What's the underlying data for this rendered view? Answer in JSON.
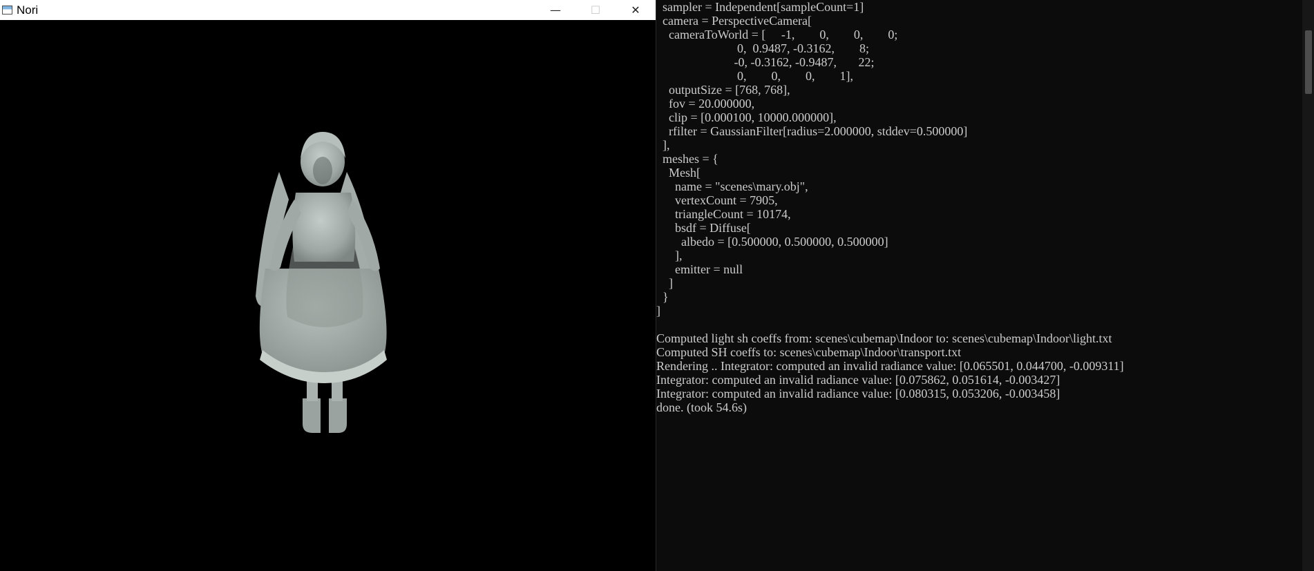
{
  "nori_window": {
    "title": "Nori",
    "app_icon": "window-icon",
    "controls": {
      "minimize": "—",
      "maximize": "☐",
      "close": "✕"
    }
  },
  "console": {
    "lines": [
      "  sampler = Independent[sampleCount=1]",
      "  camera = PerspectiveCamera[",
      "    cameraToWorld = [     -1,        0,        0,        0;",
      "                          0,  0.9487, -0.3162,        8;",
      "                         -0, -0.3162, -0.9487,       22;",
      "                          0,        0,        0,        1],",
      "    outputSize = [768, 768],",
      "    fov = 20.000000,",
      "    clip = [0.000100, 10000.000000],",
      "    rfilter = GaussianFilter[radius=2.000000, stddev=0.500000]",
      "  ],",
      "  meshes = {",
      "    Mesh[",
      "      name = \"scenes\\mary.obj\",",
      "      vertexCount = 7905,",
      "      triangleCount = 10174,",
      "      bsdf = Diffuse[",
      "        albedo = [0.500000, 0.500000, 0.500000]",
      "      ],",
      "      emitter = null",
      "    ]",
      "  }",
      "]",
      "",
      "Computed light sh coeffs from: scenes\\cubemap\\Indoor to: scenes\\cubemap\\Indoor\\light.txt",
      "Computed SH coeffs to: scenes\\cubemap\\Indoor\\transport.txt",
      "Rendering .. Integrator: computed an invalid radiance value: [0.065501, 0.044700, -0.009311]",
      "Integrator: computed an invalid radiance value: [0.075862, 0.051614, -0.003427]",
      "Integrator: computed an invalid radiance value: [0.080315, 0.053206, -0.003458]",
      "done. (took 54.6s)"
    ]
  },
  "colors": {
    "console_bg": "#0c0c0c",
    "console_text": "#cccccc",
    "viewport_bg": "#000000",
    "figure": "#a7b0ac"
  }
}
